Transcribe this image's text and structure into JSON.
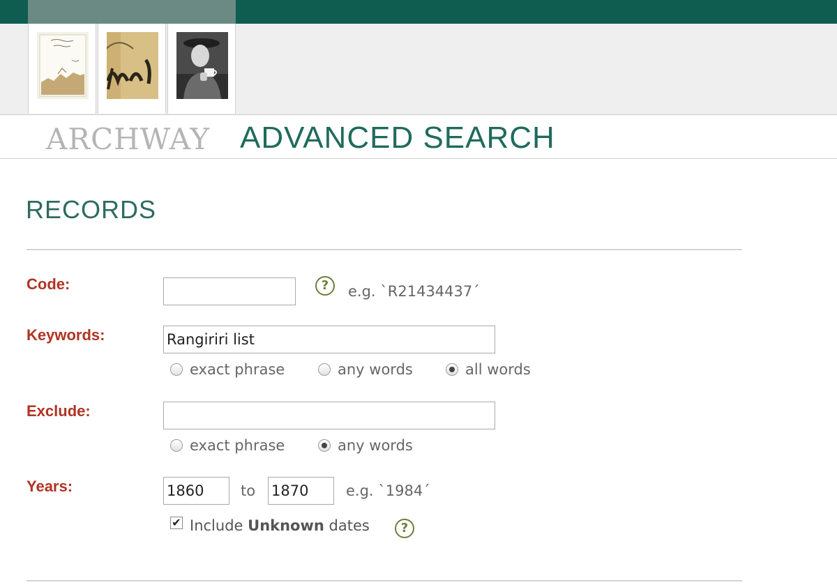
{
  "header": {
    "title_part1": "ARCHWAY",
    "title_part2": "ADVANCED SEARCH"
  },
  "section": {
    "title": "RECORDS"
  },
  "form": {
    "code": {
      "label": "Code:",
      "value": "",
      "hint": "e.g. `R21434437´",
      "help_symbol": "?"
    },
    "keywords": {
      "label": "Keywords:",
      "value": "Rangiriri list",
      "options": [
        "exact phrase",
        "any words",
        "all words"
      ],
      "selected": "all words"
    },
    "exclude": {
      "label": "Exclude:",
      "value": "",
      "options": [
        "exact phrase",
        "any words"
      ],
      "selected": "any words"
    },
    "years": {
      "label": "Years:",
      "from": "1860",
      "to_label": "to",
      "to": "1870",
      "hint": "e.g. `1984´",
      "unknown_prefix": "Include",
      "unknown_bold": "Unknown",
      "unknown_suffix": "dates",
      "unknown_checked": true,
      "help_symbol": "?"
    }
  },
  "colors": {
    "topbar": "#0f5c50",
    "title_accent": "#1f6b5c",
    "label": "#b03424",
    "help_icon": "#6e7e3a"
  }
}
